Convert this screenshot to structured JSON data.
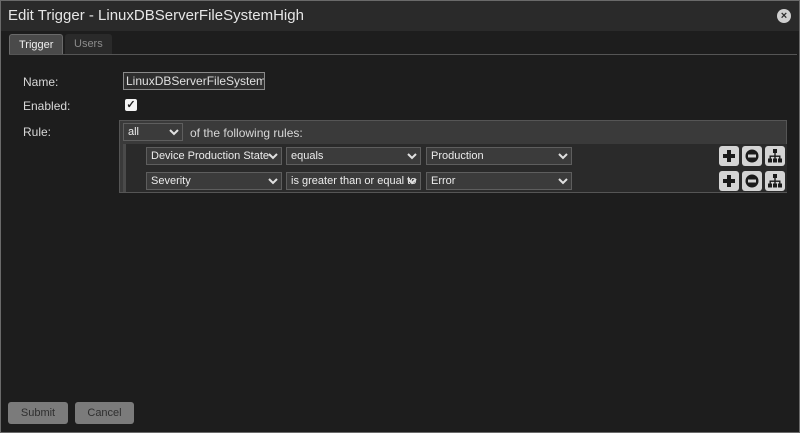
{
  "dialog": {
    "title": "Edit Trigger - LinuxDBServerFileSystemHigh",
    "close_symbol": "×"
  },
  "tabs": [
    {
      "label": "Trigger",
      "active": true
    },
    {
      "label": "Users",
      "active": false
    }
  ],
  "form": {
    "name_label": "Name:",
    "name_value": "LinuxDBServerFileSystemH",
    "enabled_label": "Enabled:",
    "enabled_checked": true,
    "rule_label": "Rule:"
  },
  "rule": {
    "match_selected": "all",
    "suffix": "of the following rules:",
    "conditions": [
      {
        "field": "Device Production State",
        "operator": "equals",
        "value": "Production"
      },
      {
        "field": "Severity",
        "operator": "is greater than or equal to",
        "value": "Error"
      }
    ]
  },
  "icons": {
    "add": "plus-icon",
    "remove": "minus-icon",
    "nest": "sitemap-icon",
    "dropdown": "chevron-down-icon"
  },
  "buttons": {
    "submit": "Submit",
    "cancel": "Cancel"
  },
  "colors": {
    "background": "#1d1d1d",
    "titlebar": "#2a2a2a",
    "rule_panel": "#3a3a3a",
    "button": "#7b7b7b"
  }
}
